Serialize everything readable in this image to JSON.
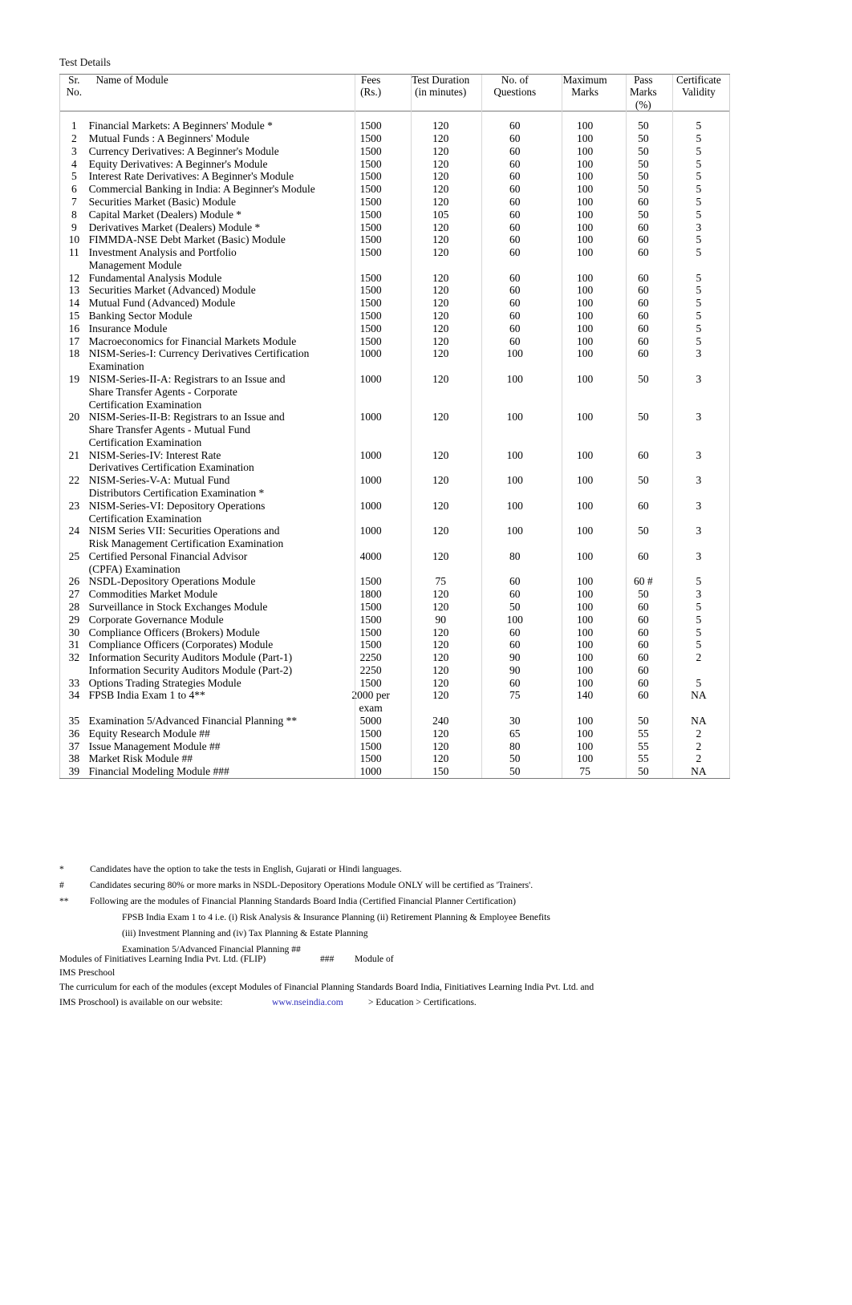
{
  "document": {
    "title": "Test Details",
    "columns": {
      "sr_no": "Sr.\nNo.",
      "name": "Name of Module",
      "fees": "Fees\n(Rs.)",
      "duration": "Test Duration\n(in minutes)",
      "questions": "No. of\nQuestions",
      "max_marks": "Maximum\nMarks",
      "pass_marks": "Pass\nMarks\n(%)",
      "validity": "Certificate\nValidity"
    },
    "rows": [
      {
        "sr": "1",
        "name": "Financial Markets: A Beginners' Module *",
        "fees": "1500",
        "duration": "120",
        "questions": "60",
        "max": "100",
        "pass": "50",
        "validity": "5"
      },
      {
        "sr": "2",
        "name": "Mutual Funds : A Beginners' Module",
        "fees": "1500",
        "duration": "120",
        "questions": "60",
        "max": "100",
        "pass": "50",
        "validity": "5"
      },
      {
        "sr": "3",
        "name": "Currency Derivatives: A Beginner's Module",
        "fees": "1500",
        "duration": "120",
        "questions": "60",
        "max": "100",
        "pass": "50",
        "validity": "5"
      },
      {
        "sr": "4",
        "name": "Equity Derivatives: A Beginner's Module",
        "fees": "1500",
        "duration": "120",
        "questions": "60",
        "max": "100",
        "pass": "50",
        "validity": "5"
      },
      {
        "sr": "5",
        "name": "Interest Rate Derivatives: A Beginner's Module",
        "fees": "1500",
        "duration": "120",
        "questions": "60",
        "max": "100",
        "pass": "50",
        "validity": "5"
      },
      {
        "sr": "6",
        "name": "Commercial Banking in India: A Beginner's Module",
        "fees": "1500",
        "duration": "120",
        "questions": "60",
        "max": "100",
        "pass": "50",
        "validity": "5"
      },
      {
        "sr": "7",
        "name": "Securities Market (Basic) Module",
        "fees": "1500",
        "duration": "120",
        "questions": "60",
        "max": "100",
        "pass": "60",
        "validity": "5"
      },
      {
        "sr": "8",
        "name": "Capital Market (Dealers) Module *",
        "fees": "1500",
        "duration": "105",
        "questions": "60",
        "max": "100",
        "pass": "50",
        "validity": "5"
      },
      {
        "sr": "9",
        "name": "Derivatives Market (Dealers) Module *",
        "fees": "1500",
        "duration": "120",
        "questions": "60",
        "max": "100",
        "pass": "60",
        "validity": "3"
      },
      {
        "sr": "10",
        "name": "FIMMDA-NSE Debt Market (Basic) Module",
        "fees": "1500",
        "duration": "120",
        "questions": "60",
        "max": "100",
        "pass": "60",
        "validity": "5"
      },
      {
        "sr": "11",
        "name": "Investment Analysis and Portfolio\nManagement Module",
        "fees": "1500",
        "duration": "120",
        "questions": "60",
        "max": "100",
        "pass": "60",
        "validity": "5"
      },
      {
        "sr": "12",
        "name": "Fundamental Analysis Module",
        "fees": "1500",
        "duration": "120",
        "questions": "60",
        "max": "100",
        "pass": "60",
        "validity": "5"
      },
      {
        "sr": "13",
        "name": "Securities Market (Advanced) Module",
        "fees": "1500",
        "duration": "120",
        "questions": "60",
        "max": "100",
        "pass": "60",
        "validity": "5"
      },
      {
        "sr": "14",
        "name": "Mutual Fund (Advanced) Module",
        "fees": "1500",
        "duration": "120",
        "questions": "60",
        "max": "100",
        "pass": "60",
        "validity": "5"
      },
      {
        "sr": "15",
        "name": "Banking Sector Module",
        "fees": "1500",
        "duration": "120",
        "questions": "60",
        "max": "100",
        "pass": "60",
        "validity": "5"
      },
      {
        "sr": "16",
        "name": "Insurance Module",
        "fees": "1500",
        "duration": "120",
        "questions": "60",
        "max": "100",
        "pass": "60",
        "validity": "5"
      },
      {
        "sr": "17",
        "name": "Macroeconomics for Financial Markets Module",
        "fees": "1500",
        "duration": "120",
        "questions": "60",
        "max": "100",
        "pass": "60",
        "validity": "5"
      },
      {
        "sr": "18",
        "name": "NISM-Series-I: Currency Derivatives Certification\nExamination",
        "fees": "1000",
        "duration": "120",
        "questions": "100",
        "max": "100",
        "pass": "60",
        "validity": "3"
      },
      {
        "sr": "19",
        "name": "NISM-Series-II-A: Registrars to an Issue and\nShare Transfer Agents - Corporate\nCertification Examination",
        "fees": "1000",
        "duration": "120",
        "questions": "100",
        "max": "100",
        "pass": "50",
        "validity": "3"
      },
      {
        "sr": "20",
        "name": "NISM-Series-II-B: Registrars to an Issue and\nShare Transfer Agents - Mutual Fund\nCertification Examination",
        "fees": "1000",
        "duration": "120",
        "questions": "100",
        "max": "100",
        "pass": "50",
        "validity": "3"
      },
      {
        "sr": "21",
        "name": "NISM-Series-IV: Interest Rate\nDerivatives Certification Examination",
        "fees": "1000",
        "duration": "120",
        "questions": "100",
        "max": "100",
        "pass": "60",
        "validity": "3"
      },
      {
        "sr": "22",
        "name": "NISM-Series-V-A: Mutual Fund\nDistributors Certification Examination *",
        "fees": "1000",
        "duration": "120",
        "questions": "100",
        "max": "100",
        "pass": "50",
        "validity": "3"
      },
      {
        "sr": "23",
        "name": "NISM-Series-VI: Depository Operations\nCertification Examination",
        "fees": "1000",
        "duration": "120",
        "questions": "100",
        "max": "100",
        "pass": "60",
        "validity": "3"
      },
      {
        "sr": "24",
        "name": "NISM Series VII: Securities Operations and\nRisk Management Certification Examination",
        "fees": "1000",
        "duration": "120",
        "questions": "100",
        "max": "100",
        "pass": "50",
        "validity": "3"
      },
      {
        "sr": "25",
        "name": "Certified Personal Financial Advisor\n(CPFA) Examination",
        "fees": "4000",
        "duration": "120",
        "questions": "80",
        "max": "100",
        "pass": "60",
        "validity": "3"
      },
      {
        "sr": "26",
        "name": "NSDL-Depository Operations Module",
        "fees": "1500",
        "duration": "75",
        "questions": "60",
        "max": "100",
        "pass": "60 #",
        "validity": "5"
      },
      {
        "sr": "27",
        "name": "Commodities Market Module",
        "fees": "1800",
        "duration": "120",
        "questions": "60",
        "max": "100",
        "pass": "50",
        "validity": "3"
      },
      {
        "sr": "28",
        "name": "Surveillance in Stock Exchanges Module",
        "fees": "1500",
        "duration": "120",
        "questions": "50",
        "max": "100",
        "pass": "60",
        "validity": "5"
      },
      {
        "sr": "29",
        "name": "Corporate Governance Module",
        "fees": "1500",
        "duration": "90",
        "questions": "100",
        "max": "100",
        "pass": "60",
        "validity": "5"
      },
      {
        "sr": "30",
        "name": "Compliance Officers (Brokers) Module",
        "fees": "1500",
        "duration": "120",
        "questions": "60",
        "max": "100",
        "pass": "60",
        "validity": "5"
      },
      {
        "sr": "31",
        "name": "Compliance Officers (Corporates) Module",
        "fees": "1500",
        "duration": "120",
        "questions": "60",
        "max": "100",
        "pass": "60",
        "validity": "5"
      },
      {
        "sr": "32",
        "name": "Information Security Auditors Module (Part-1)",
        "fees": "2250",
        "duration": "120",
        "questions": "90",
        "max": "100",
        "pass": "60",
        "validity": "2"
      },
      {
        "sr": "",
        "name": "Information Security Auditors Module (Part-2)",
        "fees": "2250",
        "duration": "120",
        "questions": "90",
        "max": "100",
        "pass": "60",
        "validity": ""
      },
      {
        "sr": "33",
        "name": "Options Trading Strategies Module",
        "fees": "1500",
        "duration": "120",
        "questions": "60",
        "max": "100",
        "pass": "60",
        "validity": "5"
      },
      {
        "sr": "34",
        "name": "FPSB India Exam 1 to 4**",
        "fees": "2000 per\nexam",
        "duration": "120",
        "questions": "75",
        "max": "140",
        "pass": "60",
        "validity": "NA"
      },
      {
        "sr": "35",
        "name": "Examination 5/Advanced Financial Planning **",
        "fees": "5000",
        "duration": "240",
        "questions": "30",
        "max": "100",
        "pass": "50",
        "validity": "NA"
      },
      {
        "sr": "36",
        "name": "Equity Research Module ##",
        "fees": "1500",
        "duration": "120",
        "questions": "65",
        "max": "100",
        "pass": "55",
        "validity": "2"
      },
      {
        "sr": "37",
        "name": "Issue Management Module ##",
        "fees": "1500",
        "duration": "120",
        "questions": "80",
        "max": "100",
        "pass": "55",
        "validity": "2"
      },
      {
        "sr": "38",
        "name": "Market Risk Module ##",
        "fees": "1500",
        "duration": "120",
        "questions": "50",
        "max": "100",
        "pass": "55",
        "validity": "2"
      },
      {
        "sr": "39",
        "name": "Financial Modeling Module ###",
        "fees": "1000",
        "duration": "150",
        "questions": "50",
        "max": "75",
        "pass": "50",
        "validity": "NA"
      }
    ],
    "footnotes": [
      {
        "mark": "*",
        "text": "Candidates have the option to take the tests in English, Gujarati or Hindi languages."
      },
      {
        "mark": "#",
        "text": "Candidates securing 80% or more marks in NSDL-Depository Operations Module ONLY will be certified as 'Trainers'."
      },
      {
        "mark": "**",
        "text": "Following are the modules of Financial Planning Standards Board India (Certified Financial Planner Certification)"
      }
    ],
    "footnote_indented": [
      "FPSB India Exam 1 to 4 i.e. (i) Risk Analysis & Insurance Planning (ii) Retirement Planning & Employee Benefits",
      "(iii) Investment Planning and (iv) Tax Planning & Estate Planning",
      "Examination 5/Advanced Financial Planning ##"
    ],
    "flip_line": {
      "segment1": "Modules of Finitiatives Learning India Pvt. Ltd. (FLIP)",
      "segment2": "###",
      "segment3": "Module of"
    },
    "ims_line": "IMS Preschool",
    "curriculum_line": "The curriculum for each of the modules (except Modules of Financial Planning Standards Board India, Finitiatives Learning India Pvt. Ltd. and",
    "website_line": {
      "label": "IMS Proschool) is available on our website:",
      "url": "www.nseindia.com",
      "tail": "> Education > Certifications."
    }
  },
  "colors": {
    "text": "#000000",
    "link": "#2b2bbb",
    "rule": "#7a7a7a",
    "column_separator": "#d8d8d8"
  }
}
